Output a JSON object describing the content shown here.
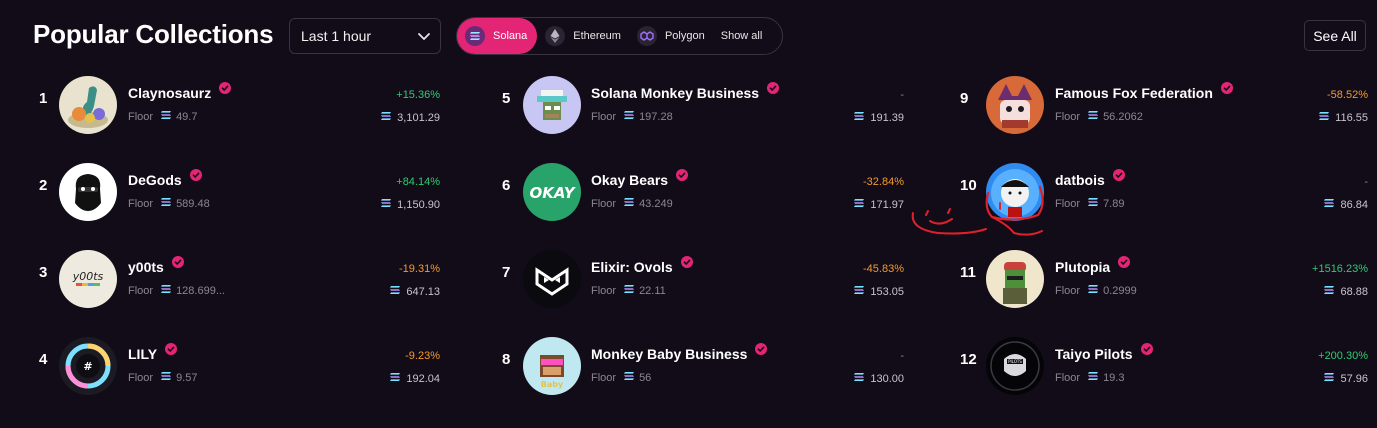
{
  "header": {
    "title": "Popular Collections",
    "time_range": "Last 1 hour",
    "chains": [
      {
        "label": "Solana",
        "icon": "solana-icon",
        "active": true
      },
      {
        "label": "Ethereum",
        "icon": "ethereum-icon",
        "active": false
      },
      {
        "label": "Polygon",
        "icon": "polygon-icon",
        "active": false
      },
      {
        "label": "Show all",
        "icon": "",
        "active": false
      }
    ],
    "see_all": "See All"
  },
  "floor_label": "Floor",
  "colors": {
    "background": "#120c18",
    "accent": "#e42575",
    "positive": "#2ecc71",
    "negative": "#f39a2b",
    "verified": "#e42575"
  },
  "collections": [
    {
      "rank": "1",
      "name": "Claynosaurz",
      "floor": "49.7",
      "change": "+15.36%",
      "trend": "pos",
      "volume": "3,101.29",
      "avatar": "claynosaurz-avatar"
    },
    {
      "rank": "2",
      "name": "DeGods",
      "floor": "589.48",
      "change": "+84.14%",
      "trend": "pos",
      "volume": "1,150.90",
      "avatar": "degods-avatar"
    },
    {
      "rank": "3",
      "name": "y00ts",
      "floor": "128.699...",
      "change": "-19.31%",
      "trend": "neg",
      "volume": "647.13",
      "avatar": "y00ts-avatar"
    },
    {
      "rank": "4",
      "name": "LILY",
      "floor": "9.57",
      "change": "-9.23%",
      "trend": "neg",
      "volume": "192.04",
      "avatar": "lily-avatar"
    },
    {
      "rank": "5",
      "name": "Solana Monkey Business",
      "floor": "197.28",
      "change": "-",
      "trend": "neu",
      "volume": "191.39",
      "avatar": "smb-avatar"
    },
    {
      "rank": "6",
      "name": "Okay Bears",
      "floor": "43.249",
      "change": "-32.84%",
      "trend": "neg",
      "volume": "171.97",
      "avatar": "okay-bears-avatar"
    },
    {
      "rank": "7",
      "name": "Elixir: Ovols",
      "floor": "22.11",
      "change": "-45.83%",
      "trend": "neg",
      "volume": "153.05",
      "avatar": "ovols-avatar"
    },
    {
      "rank": "8",
      "name": "Monkey Baby Business",
      "floor": "56",
      "change": "-",
      "trend": "neu",
      "volume": "130.00",
      "avatar": "mbb-avatar"
    },
    {
      "rank": "9",
      "name": "Famous Fox Federation",
      "floor": "56.2062",
      "change": "-58.52%",
      "trend": "neg",
      "volume": "116.55",
      "avatar": "fox-avatar"
    },
    {
      "rank": "10",
      "name": "datbois",
      "floor": "7.89",
      "change": "-",
      "trend": "neu",
      "volume": "86.84",
      "avatar": "datbois-avatar"
    },
    {
      "rank": "11",
      "name": "Plutopia",
      "floor": "0.2999",
      "change": "+1516.23%",
      "trend": "pos",
      "volume": "68.88",
      "avatar": "plutopia-avatar"
    },
    {
      "rank": "12",
      "name": "Taiyo Pilots",
      "floor": "19.3",
      "change": "+200.30%",
      "trend": "pos",
      "volume": "57.96",
      "avatar": "taiyo-avatar"
    }
  ]
}
